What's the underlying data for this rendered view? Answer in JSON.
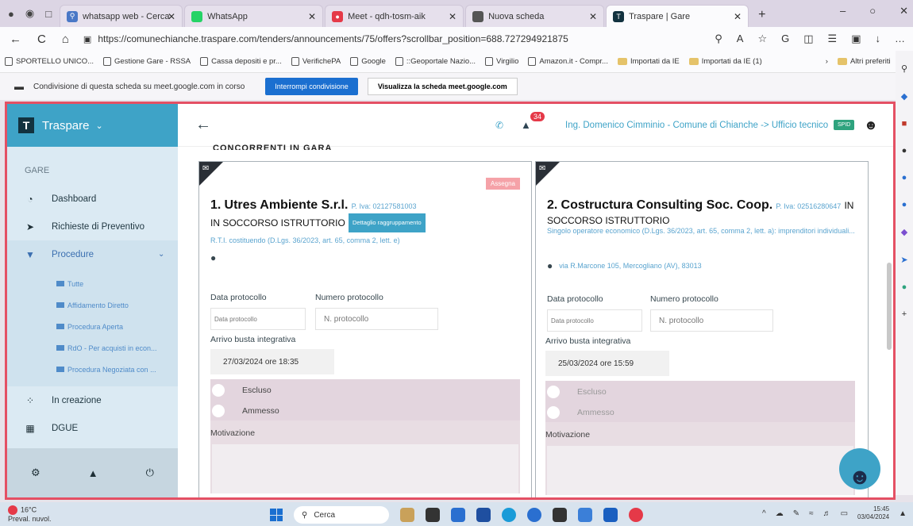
{
  "browser": {
    "tabs": [
      {
        "label": "whatsapp web - Cerca",
        "fav_color": "#4a78c6"
      },
      {
        "label": "WhatsApp",
        "fav_color": "#25d366"
      },
      {
        "label": "Meet - qdh-tosm-aik",
        "fav_color": "#e53948"
      },
      {
        "label": "Nuova scheda",
        "fav_color": "#555555"
      },
      {
        "label": "Traspare | Gare",
        "fav_color": "#12323f"
      }
    ],
    "url": "https://comunechianche.traspare.com/tenders/announcements/75/offers?scrollbar_position=688.727294921875",
    "bookmarks": [
      {
        "label": "SPORTELLO UNICO...",
        "type": "page"
      },
      {
        "label": "Gestione Gare - RSSA",
        "type": "page"
      },
      {
        "label": "Cassa depositi e pr...",
        "type": "page"
      },
      {
        "label": "VerifichePA",
        "type": "page"
      },
      {
        "label": "Google",
        "type": "page"
      },
      {
        "label": "::Geoportale Nazio...",
        "type": "page"
      },
      {
        "label": "Virgilio",
        "type": "page"
      },
      {
        "label": "Amazon.it - Compr...",
        "type": "page"
      },
      {
        "label": "Importati da IE",
        "type": "folder"
      },
      {
        "label": "Importati da IE (1)",
        "type": "folder"
      },
      {
        "label": "Altri preferiti",
        "type": "folder"
      }
    ],
    "share_text": "Condivisione di questa scheda su meet.google.com in corso",
    "share_stop": "Interrompi condivisione",
    "share_view": "Visualizza la scheda meet.google.com"
  },
  "app": {
    "brand": "Traspare",
    "section": "GARE",
    "nav": [
      {
        "label": "Dashboard",
        "icon": "dashboard-icon"
      },
      {
        "label": "Richieste di Preventivo",
        "icon": "send-icon"
      },
      {
        "label": "Procedure",
        "icon": "trophy-icon"
      }
    ],
    "sub": [
      "Tutte",
      "Affidamento Diretto",
      "Procedura Aperta",
      "RdO - Per acquisti in econ...",
      "Procedura Negoziata con ..."
    ],
    "nav2": [
      {
        "label": "In creazione",
        "icon": "spinner-icon"
      },
      {
        "label": "DGUE",
        "icon": "document-icon"
      }
    ],
    "notifications": "34",
    "user": "Ing. Domenico Cimminio - Comune di Chianche -> Ufficio tecnico",
    "spid": "SPID",
    "cut_heading": "CONCORRENTI IN GARA"
  },
  "offers": [
    {
      "index": "1.",
      "name": "Utres Ambiente S.r.l.",
      "piva": "P. Iva: 02127581003",
      "status": "IN SOCCORSO ISTRUTTORIO",
      "detail_button": "Dettaglio raggruppamento",
      "assign": "Assegna",
      "type": "R.T.I. costituendo (D.Lgs. 36/2023, art. 65, comma 2, lett. e)",
      "address": "",
      "data_protocollo_label": "Data protocollo",
      "data_protocollo_placeholder": "Data protocollo",
      "numero_protocollo_label": "Numero protocollo",
      "numero_protocollo_placeholder": "N. protocollo",
      "arrivo_label": "Arrivo busta integrativa",
      "arrivo_value": "27/03/2024 ore 18:35",
      "escluso": "Escluso",
      "ammesso": "Ammesso",
      "motivazione": "Motivazione"
    },
    {
      "index": "2.",
      "name": "Costructura Consulting Soc. Coop.",
      "piva": "P. Iva: 02516280647",
      "status": "IN SOCCORSO ISTRUTTORIO",
      "type": "Singolo operatore economico (D.Lgs. 36/2023, art. 65, comma 2, lett. a): imprenditori individuali...",
      "address": "via R.Marcone 105, Mercogliano (AV), 83013",
      "data_protocollo_label": "Data protocollo",
      "data_protocollo_placeholder": "Data protocollo",
      "numero_protocollo_label": "Numero protocollo",
      "numero_protocollo_placeholder": "N. protocollo",
      "arrivo_label": "Arrivo busta integrativa",
      "arrivo_value": "25/03/2024 ore 15:59",
      "escluso": "Escluso",
      "ammesso": "Ammesso",
      "motivazione": "Motivazione"
    }
  ],
  "taskbar": {
    "temp": "16°C",
    "weather": "Preval. nuvol.",
    "search": "Cerca",
    "time": "15:45",
    "date": "03/04/2024"
  }
}
